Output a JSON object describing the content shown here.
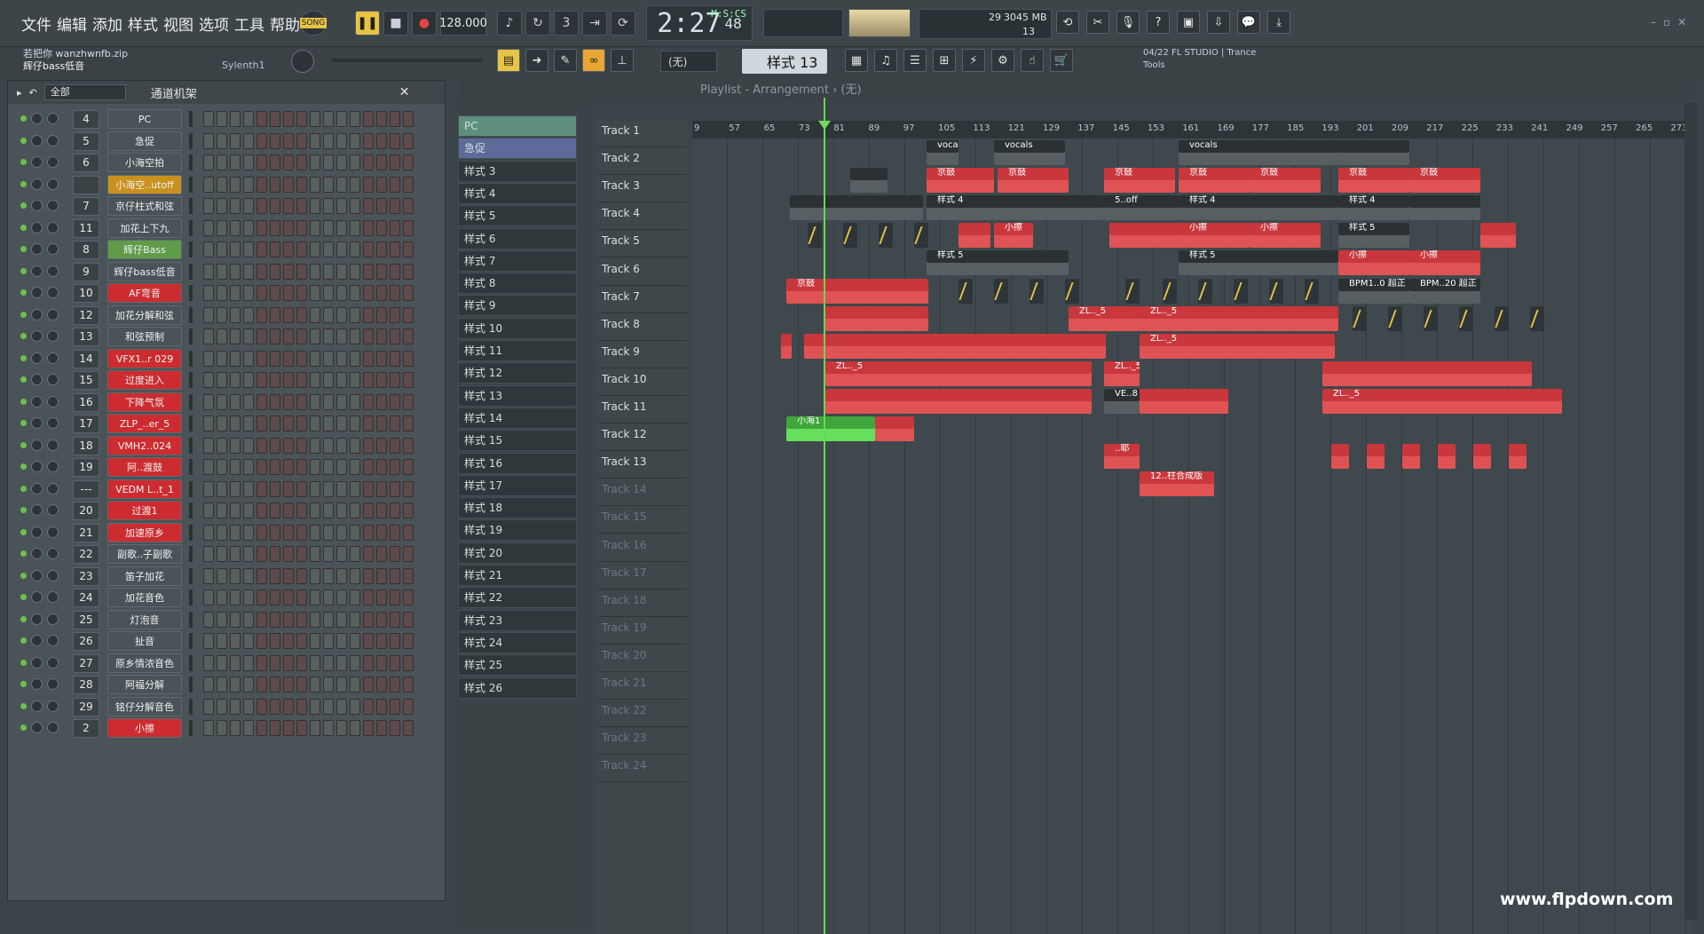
{
  "menu": [
    "文件",
    "编辑",
    "添加",
    "样式",
    "视图",
    "选项",
    "工具",
    "帮助"
  ],
  "transport": {
    "song_label": "SONG",
    "tempo": "128.000",
    "time": "2:27",
    "time_small": "48",
    "time_unit": "M:S:CS"
  },
  "cpu": {
    "mem": "3045 MB",
    "val1": "29",
    "val2": "13"
  },
  "hint": {
    "line1": "若把你 wanzhwnfb.zip",
    "line2": "辉仔bass低音",
    "plugin": "Sylenth1"
  },
  "pattern_select": "样式 13",
  "none_select": "(无)",
  "brand": {
    "line1": "04/22  FL STUDIO | Trance",
    "line2": "Tools"
  },
  "rack": {
    "title": "通道机架",
    "filter": "全部",
    "channels": [
      {
        "num": "4",
        "name": "PC",
        "color": "#4a5357"
      },
      {
        "num": "5",
        "name": "急促",
        "color": "#4a5357"
      },
      {
        "num": "6",
        "name": "小海空拍",
        "color": "#4a5357"
      },
      {
        "num": "",
        "name": "小海空..utoff",
        "color": "#c9911e"
      },
      {
        "num": "7",
        "name": "京仔柱式和弦",
        "color": "#4a5357"
      },
      {
        "num": "11",
        "name": "加花上下九",
        "color": "#4a5357"
      },
      {
        "num": "8",
        "name": "辉仔Bass",
        "color": "#5f9b49"
      },
      {
        "num": "9",
        "name": "辉仔bass低音",
        "color": "#4a5357"
      },
      {
        "num": "10",
        "name": "AF弯音",
        "color": "#cc2c30"
      },
      {
        "num": "12",
        "name": "加花分解和弦",
        "color": "#4a5357"
      },
      {
        "num": "13",
        "name": "和弦预制",
        "color": "#4a5357"
      },
      {
        "num": "14",
        "name": "VFX1..r 029",
        "color": "#cc2c30"
      },
      {
        "num": "15",
        "name": "过度进入",
        "color": "#cc2c30"
      },
      {
        "num": "16",
        "name": "下降气氛",
        "color": "#cc2c30"
      },
      {
        "num": "17",
        "name": "ZLP_..er_5",
        "color": "#cc2c30"
      },
      {
        "num": "18",
        "name": "VMH2..024",
        "color": "#cc2c30"
      },
      {
        "num": "19",
        "name": "阿..渡鼓",
        "color": "#cc2c30"
      },
      {
        "num": "---",
        "name": "VEDM L..t_1",
        "color": "#cc2c30"
      },
      {
        "num": "20",
        "name": "过渡1",
        "color": "#cc2c30"
      },
      {
        "num": "21",
        "name": "加速原乡",
        "color": "#cc2c30"
      },
      {
        "num": "22",
        "name": "副歌..子副歌",
        "color": "#4a5357"
      },
      {
        "num": "23",
        "name": "笛子加花",
        "color": "#4a5357"
      },
      {
        "num": "24",
        "name": "加花音色",
        "color": "#4a5357"
      },
      {
        "num": "25",
        "name": "灯泡音",
        "color": "#4a5357"
      },
      {
        "num": "26",
        "name": "扯音",
        "color": "#4a5357"
      },
      {
        "num": "27",
        "name": "原乡情浓音色",
        "color": "#4a5357"
      },
      {
        "num": "28",
        "name": "阿福分解",
        "color": "#4a5357"
      },
      {
        "num": "29",
        "name": "铭仔分解音色",
        "color": "#4a5357"
      },
      {
        "num": "2",
        "name": "小擦",
        "color": "#cc2c30"
      }
    ]
  },
  "patterns": [
    "PC",
    "急促",
    "样式 3",
    "样式 4",
    "样式 5",
    "样式 6",
    "样式 7",
    "样式 8",
    "样式 9",
    "样式 10",
    "样式 11",
    "样式 12",
    "样式 13",
    "样式 14",
    "样式 15",
    "样式 16",
    "样式 17",
    "样式 18",
    "样式 19",
    "样式 20",
    "样式 21",
    "样式 22",
    "样式 23",
    "样式 24",
    "样式 25",
    "样式 26"
  ],
  "playlist": {
    "title": "Playlist - Arrangement › (无)",
    "tracks": [
      "Track 1",
      "Track 2",
      "Track 3",
      "Track 4",
      "Track 5",
      "Track 6",
      "Track 7",
      "Track 8",
      "Track 9",
      "Track 10",
      "Track 11",
      "Track 12",
      "Track 13",
      "Track 14",
      "Track 15",
      "Track 16",
      "Track 17",
      "Track 18",
      "Track 19",
      "Track 20",
      "Track 21",
      "Track 22",
      "Track 23",
      "Track 24"
    ],
    "ruler": [
      "9",
      "57",
      "65",
      "73",
      "81",
      "89",
      "97",
      "105",
      "113",
      "121",
      "129",
      "137",
      "145",
      "153",
      "161",
      "169",
      "177",
      "185",
      "193",
      "201",
      "209",
      "217",
      "225",
      "233",
      "241",
      "249",
      "257",
      "265",
      "273"
    ]
  },
  "clip_labels": {
    "vocals": "vocals",
    "jinggu": "京鼓",
    "xiaoca": "小擦",
    "pattern4": "样式 4",
    "pattern5": "样式 5",
    "xiaohai": "小海1",
    "bpm1": "BPM1..0 超正",
    "bpm2": "BPM..20 超正",
    "zl": "ZL.._5",
    "ve": "VE..8",
    "zhu": "12..柱合成版",
    "ye": "..耶",
    "soff": "5..off"
  },
  "watermark": "www.flpdown.com"
}
